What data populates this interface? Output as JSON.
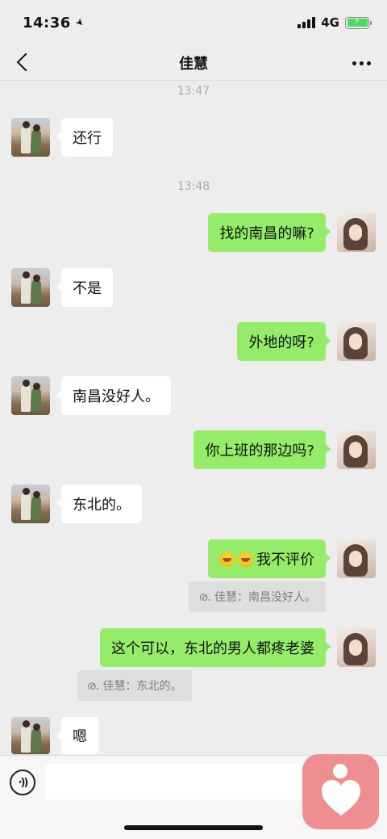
{
  "status_bar": {
    "time": "14:36",
    "network": "4G",
    "battery_level": 1.0,
    "battery_color": "#4cd964"
  },
  "header": {
    "title": "佳慧",
    "back_icon": "chevron-left-icon",
    "more_icon": "more-dots-icon"
  },
  "chat": {
    "time_1": "13:47",
    "time_2": "13:48",
    "messages": [
      {
        "from": "other",
        "text": "还行"
      },
      {
        "from": "me",
        "text": "找的南昌的嘛?"
      },
      {
        "from": "other",
        "text": "不是"
      },
      {
        "from": "me",
        "text": "外地的呀?"
      },
      {
        "from": "other",
        "text": "南昌没好人。"
      },
      {
        "from": "me",
        "text": "你上班的那边吗?"
      },
      {
        "from": "other",
        "text": "东北的。"
      },
      {
        "from": "me",
        "text": "我不评价",
        "emoji_prefix": "laughing-crying-emoji x2"
      },
      {
        "from": "me",
        "text": "这个可以，东北的男人都疼老婆"
      },
      {
        "from": "other",
        "text": "嗯"
      }
    ],
    "quote_1": "佳慧：南昌没好人。",
    "quote_2": "佳慧：东北的。"
  },
  "input_bar": {
    "voice_icon": "voice-icon",
    "app_icon": "heart-app-icon",
    "accent_color": "#ef8e91"
  },
  "colors": {
    "sent_bubble": "#95ec69",
    "received_bubble": "#ffffff",
    "background": "#ededed"
  }
}
